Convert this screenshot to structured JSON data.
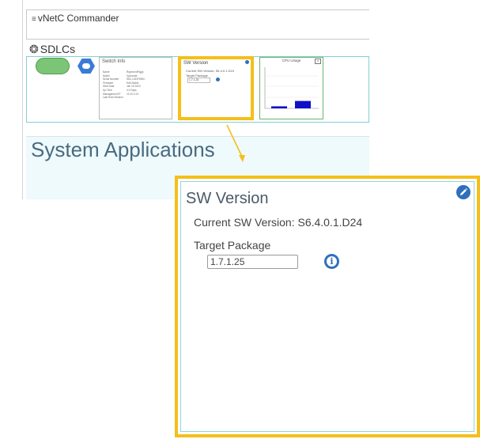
{
  "app": {
    "title": "vNetC Commander",
    "title_icon": "tree-icon"
  },
  "sdlcs": {
    "heading": "SDLCs",
    "icon": "gear-icon"
  },
  "switch_info": {
    "title": "Switch Info",
    "rows": [
      {
        "label": "Name",
        "value": "RaymondFiggs"
      },
      {
        "label": "Model",
        "value": "Xpicorate"
      },
      {
        "label": "Serial Number",
        "value": "SDL-C4DF9354"
      },
      {
        "label": "Firmware",
        "value": "Edit Stable"
      },
      {
        "label": "Start Date",
        "value": "Jan 15 2019"
      },
      {
        "label": "Up Time",
        "value": "4.0 Days"
      },
      {
        "label": "Management IP",
        "value": "10.10.0.13"
      },
      {
        "label": "Last Host Session",
        "value": ""
      }
    ]
  },
  "sw_version_mini": {
    "title": "SW Version",
    "current": "Current SW Version: S6.4.0.1.D24",
    "target_label": "Target Package",
    "target_value": "1.7.1.25"
  },
  "cpu_usage": {
    "title": "CPU Usage",
    "close_label": "x",
    "bar_values": [
      0.05,
      0.18
    ],
    "bar_colors": [
      "#1010c8",
      "#1010c8"
    ]
  },
  "system_applications": {
    "title": "System Applications"
  },
  "sw_version": {
    "title": "SW Version",
    "current_label": "Current SW Version: S6.4.0.1.D24",
    "target_label": "Target Package",
    "target_value": "1.7.1.25"
  },
  "colors": {
    "accent": "#f5bf19",
    "icon_blue": "#2f6fbf",
    "panel_border": "#8fd8da",
    "title_text": "#4a5a68"
  }
}
